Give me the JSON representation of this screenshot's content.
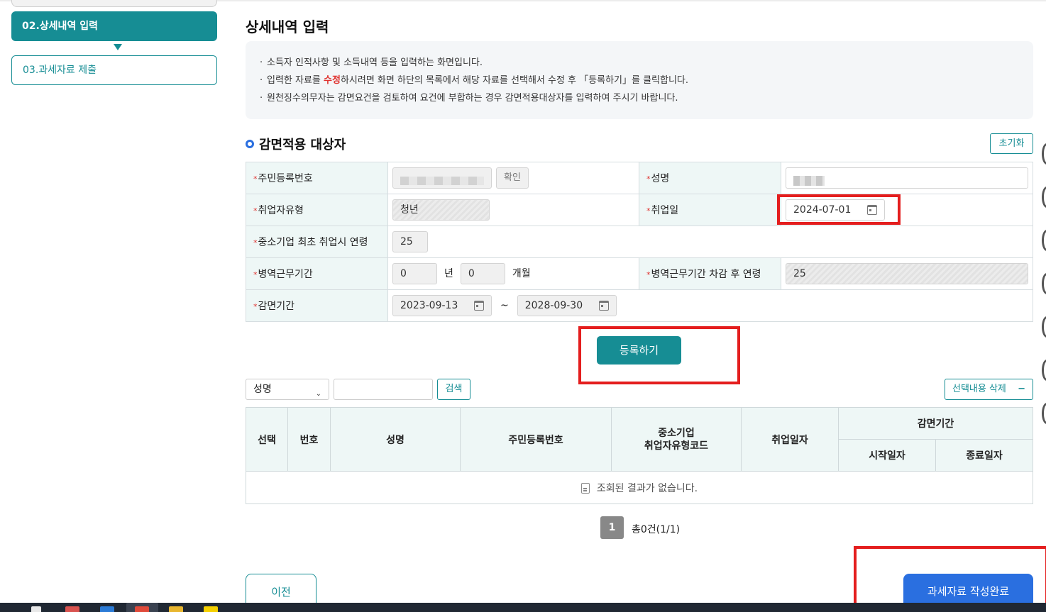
{
  "sidebar": {
    "active_step": "02.상세내역 입력",
    "next_step": "03.과세자료 제출"
  },
  "page": {
    "title": "상세내역 입력",
    "info": [
      "소득자 인적사항 및 소득내역 등을 입력하는 화면입니다.",
      "원천징수의무자는 감면요건을 검토하여 요건에 부합하는 경우 감면적용대상자를 입력하여 주시기 바랍니다."
    ],
    "info_edit_pre": "입력한 자료를 ",
    "info_edit_red": "수정",
    "info_edit_post": "하시려면 화면 하단의 목록에서 해당 자료를 선택해서 수정 후 「등록하기」를 클릭합니다."
  },
  "section": {
    "title": "감면적용 대상자",
    "reset_label": "초기화"
  },
  "form": {
    "rrn_label": "주민등록번호",
    "confirm_label": "확인",
    "name_label": "성명",
    "emp_type_label": "취업자유형",
    "emp_type_value": "청년",
    "emp_date_label": "취업일",
    "emp_date_value": "2024-07-01",
    "first_age_label": "중소기업 최초 취업시 연령",
    "first_age_value": "25",
    "military_label": "병역근무기간",
    "military_years": "0",
    "years_unit": "년",
    "military_months": "0",
    "months_unit": "개월",
    "adj_age_label": "병역근무기간 차감 후 연령",
    "adj_age_value": "25",
    "period_label": "감면기간",
    "period_start": "2023-09-13",
    "period_sep": "~",
    "period_end": "2028-09-30"
  },
  "register_label": "등록하기",
  "search": {
    "select_value": "성명",
    "button_label": "검색",
    "delete_label": "선택내용 삭제",
    "delete_symbol": "−"
  },
  "list": {
    "headers": {
      "select": "선택",
      "no": "번호",
      "name": "성명",
      "rrn": "주민등록번호",
      "type_code_1": "중소기업",
      "type_code_2": "취업자유형코드",
      "emp_date": "취업일자",
      "period": "감면기간",
      "start": "시작일자",
      "end": "종료일자"
    },
    "empty_message": "조회된 결과가 없습니다."
  },
  "pagination": {
    "current": "1",
    "total": "총0건(1/1)"
  },
  "footer": {
    "prev_label": "이전",
    "done_label": "과세자료 작성완료"
  },
  "colors": {
    "teal": "#168d94",
    "blue": "#2a6fe0",
    "highlight_red": "#e41e1e"
  }
}
